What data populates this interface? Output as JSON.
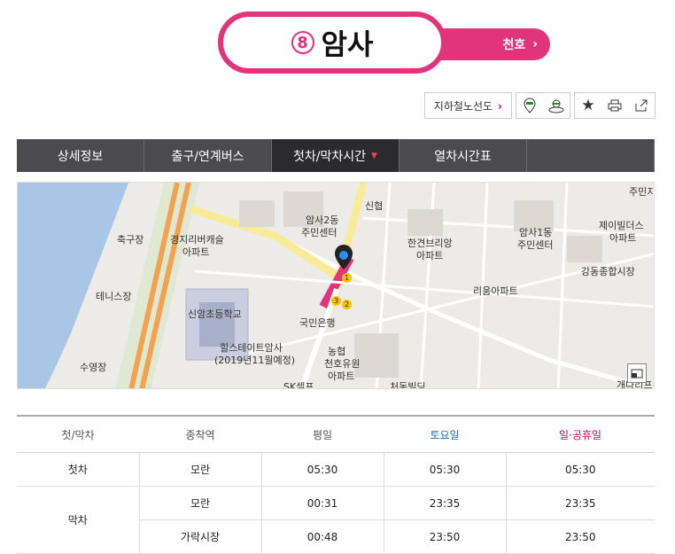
{
  "station": {
    "line_number": "8",
    "name": "암사",
    "next_label": "천호"
  },
  "tools": {
    "subway_map": "지하철노선도"
  },
  "tabs": [
    {
      "label": "상세정보"
    },
    {
      "label": "출구/연계버스"
    },
    {
      "label": "첫차/막차시간"
    },
    {
      "label": "열차시간표"
    }
  ],
  "map": {
    "labels": {
      "a1": "주민지",
      "a2": "신협",
      "a3": "암사2동",
      "a4": "주민센터",
      "a5": "축구장",
      "a6": "경지리버캐슬",
      "a7": "아파트",
      "a8": "한견브리앙",
      "a9": "아파트",
      "a10": "암사1동",
      "a11": "주민센터",
      "a12": "제이빌더스",
      "a13": "아파트",
      "a14": "강동종합시장",
      "a15": "테니스장",
      "a16": "리움아파트",
      "a17": "신암초등학교",
      "a18": "국민은행",
      "a19": "힐스테이트암사",
      "a20": "(2019년11월예정)",
      "a21": "농협",
      "a22": "수영장",
      "a23": "천호유원",
      "a24": "아파트",
      "a25": "SK셀프",
      "a26": "처동빌딩",
      "a27": "개나리프"
    },
    "exits": [
      "1",
      "2",
      "3"
    ],
    "colors": {
      "line8": "#e2347a",
      "road_major": "#f3a24f",
      "road_yellow": "#f7eb9a"
    }
  },
  "table": {
    "headers": [
      "첫/막차",
      "종착역",
      "평일",
      "토요일",
      "일·공휴일"
    ],
    "first": {
      "label": "첫차",
      "rows": [
        {
          "dest": "모란",
          "weekday": "05:30",
          "saturday": "05:30",
          "holiday": "05:30"
        }
      ]
    },
    "last": {
      "label": "막차",
      "rows": [
        {
          "dest": "모란",
          "weekday": "00:31",
          "saturday": "23:35",
          "holiday": "23:35"
        },
        {
          "dest": "가락시장",
          "weekday": "00:48",
          "saturday": "23:50",
          "holiday": "23:50"
        }
      ]
    }
  }
}
